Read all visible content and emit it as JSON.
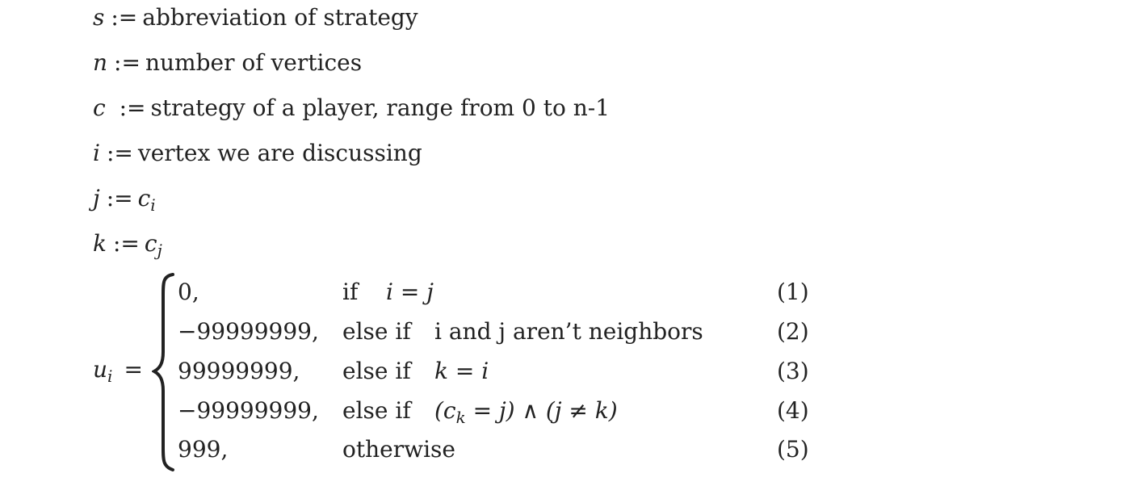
{
  "definitions": [
    {
      "symbol": "s",
      "assign": ":=",
      "text": "abbreviation of strategy"
    },
    {
      "symbol": "n",
      "assign": ":=",
      "text": "number of vertices"
    },
    {
      "symbol": "c",
      "assign": " :=",
      "text": "strategy of a player, range from 0 to n-1"
    },
    {
      "symbol": "i",
      "assign": ":=",
      "text": "vertex we are discussing"
    },
    {
      "symbol": "j",
      "assign": ":=",
      "rhs_base": "c",
      "rhs_sub": "i"
    },
    {
      "symbol": "k",
      "assign": ":=",
      "rhs_base": "c",
      "rhs_sub": "j"
    }
  ],
  "equation": {
    "lhs_base": "u",
    "lhs_sub": "i",
    "equals": "=",
    "cases": [
      {
        "value": "0,",
        "keyword": "if",
        "condition": "i = j",
        "number": "(1)"
      },
      {
        "value": "−99999999,",
        "keyword": "else if",
        "condition": "i and j aren’t neighbors",
        "number": "(2)"
      },
      {
        "value": "99999999,",
        "keyword": "else if",
        "condition": "k = i",
        "number": "(3)"
      },
      {
        "value": "−99999999,",
        "keyword": "else if",
        "condition_prefix": "(c",
        "condition_sub": "k",
        "condition_suffix": " = j) ∧ (j ≠ k)",
        "number": "(4)"
      },
      {
        "value": "999,",
        "keyword": "otherwise",
        "condition": "",
        "number": "(5)"
      }
    ]
  }
}
